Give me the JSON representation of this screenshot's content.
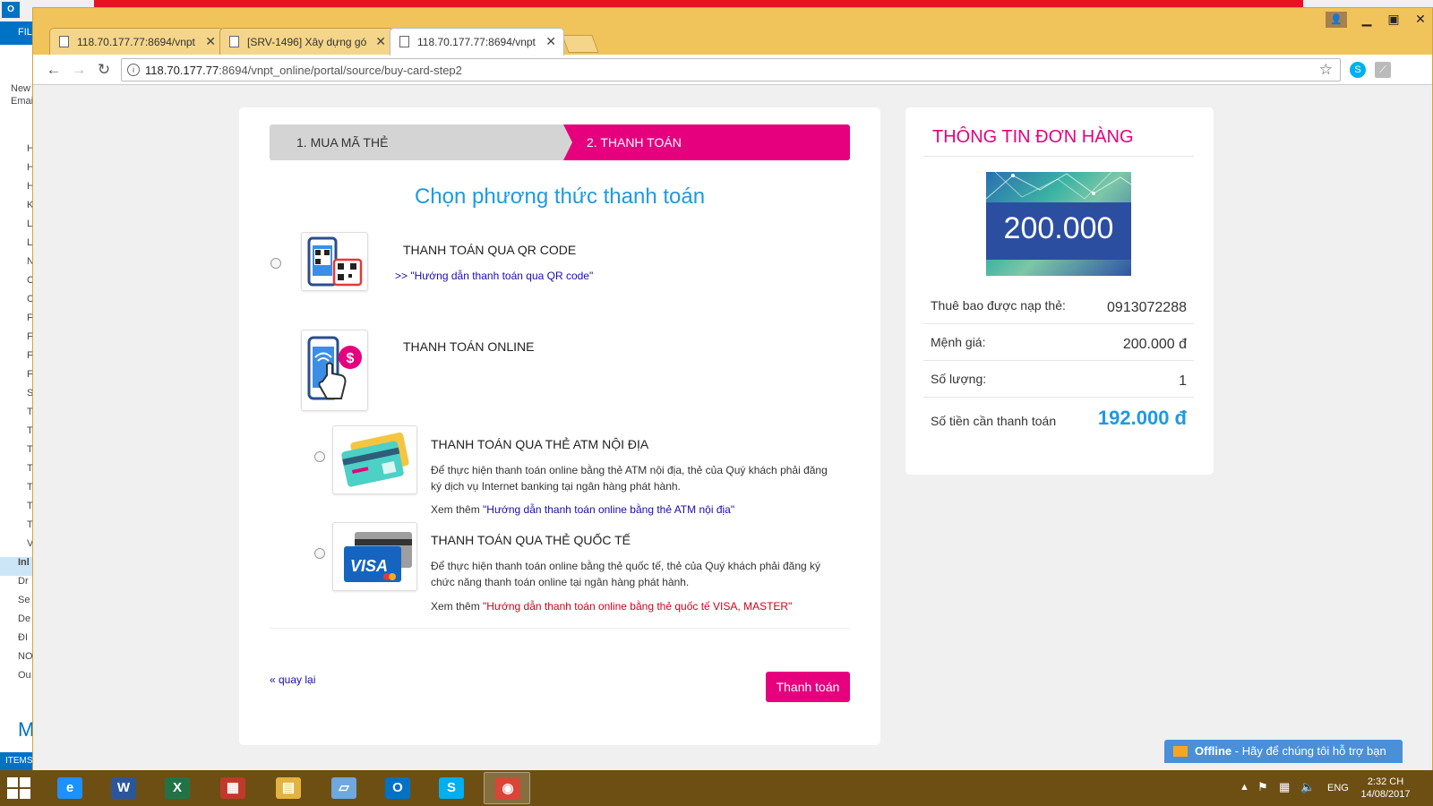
{
  "outlook": {
    "file_label": "FIL",
    "new_email_label": "New Emai",
    "left_letters": [
      "H",
      "H",
      "H",
      "K",
      "L",
      "L",
      "N",
      "C",
      "C",
      "F",
      "F",
      "F",
      "F",
      "S",
      "T",
      "T",
      "T",
      "T",
      "T",
      "T",
      "T",
      "V"
    ],
    "folders": [
      "Inl",
      "Dr",
      "Se",
      "De",
      "ĐI",
      "NO",
      "Ou"
    ],
    "items_label": "ITEMS",
    "m_label": "M"
  },
  "browser": {
    "tabs": [
      {
        "title": "118.70.177.77:8694/vnpt"
      },
      {
        "title": "[SRV-1496] Xây dựng gó"
      },
      {
        "title": "118.70.177.77:8694/vnpt"
      }
    ],
    "url_host": "118.70.177.77",
    "url_rest": ":8694/vnpt_online/portal/source/buy-card-step2"
  },
  "steps": {
    "step1": "1. MUA MÃ THẺ",
    "step2": "2. THANH TOÁN"
  },
  "section_title": "Chọn phương thức thanh toán",
  "options": {
    "qr": {
      "title": "THANH TOÁN QUA QR CODE",
      "link": ">> \"Hướng dẫn thanh toán qua QR code\""
    },
    "online": {
      "title": "THANH TOÁN ONLINE"
    },
    "atm": {
      "title": "THANH TOÁN QUA THẺ ATM NỘI ĐỊA",
      "desc": "Để thực hiện thanh toán online bằng thẻ ATM nội địa, thẻ của Quý khách phải đăng ký dịch vụ Internet banking tại ngân hàng phát hành.",
      "see_more": "Xem thêm ",
      "link": "\"Hướng dẫn thanh toán online bằng thẻ ATM nội địa\""
    },
    "intl": {
      "title": "THANH TOÁN QUA THẺ QUỐC TẾ",
      "desc": "Để thực hiện thanh toán online bằng thẻ quốc tế, thẻ của Quý khách phải đăng ký chức năng thanh toán online tại ngân hàng phát hành.",
      "see_more": "Xem thêm ",
      "link": "\"Hướng dẫn thanh toán online bằng thẻ quốc tế VISA, MASTER\""
    }
  },
  "back_link": "« quay lại",
  "pay_button": "Thanh toán",
  "order": {
    "title": "THÔNG TIN ĐƠN HÀNG",
    "card_amount": "200.000",
    "rows": [
      {
        "label": "Thuê bao được nạp thẻ:",
        "value": "0913072288"
      },
      {
        "label": "Mệnh giá:",
        "value": "200.000 đ"
      },
      {
        "label": "Số lượng:",
        "value": "1"
      },
      {
        "label": "Số tiền cần thanh toán",
        "value": "192.000 đ"
      }
    ]
  },
  "chat": {
    "status": "Offline",
    "message": " - Hãy để chúng tôi hỗ trợ bạn"
  },
  "taskbar": {
    "apps": [
      {
        "name": "internet-explorer",
        "glyph": "e",
        "color": "#1e90ff"
      },
      {
        "name": "word",
        "glyph": "W",
        "color": "#2b579a"
      },
      {
        "name": "excel",
        "glyph": "X",
        "color": "#217346"
      },
      {
        "name": "network-tool",
        "glyph": "▦",
        "color": "#c0392b"
      },
      {
        "name": "file-explorer",
        "glyph": "▤",
        "color": "#e3b341"
      },
      {
        "name": "notepad",
        "glyph": "▱",
        "color": "#6fa8dc"
      },
      {
        "name": "outlook",
        "glyph": "O",
        "color": "#0072c6"
      },
      {
        "name": "skype",
        "glyph": "S",
        "color": "#00aff0"
      },
      {
        "name": "chrome",
        "glyph": "◉",
        "color": "#db4437"
      }
    ],
    "lang": "ENG",
    "time": "2:32 CH",
    "date": "14/08/2017"
  },
  "colors": {
    "accent_pink": "#e6007e",
    "accent_blue": "#1e9ae0",
    "link_blue": "#1a0dab",
    "link_red": "#d0021b"
  }
}
